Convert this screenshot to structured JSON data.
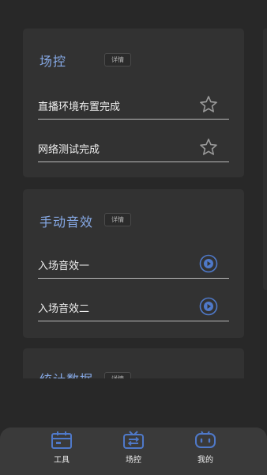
{
  "cards": [
    {
      "title": "场控",
      "detail_label": "详情",
      "items": [
        {
          "label": "直播环境布置完成",
          "icon": "star-outline-icon"
        },
        {
          "label": "网络测试完成",
          "icon": "star-outline-icon"
        }
      ]
    },
    {
      "title": "手动音效",
      "detail_label": "详情",
      "items": [
        {
          "label": "入场音效一",
          "icon": "play-circle-icon"
        },
        {
          "label": "入场音效二",
          "icon": "play-circle-icon"
        }
      ]
    },
    {
      "title": "统计数据",
      "detail_label": "详情",
      "items": []
    }
  ],
  "tabbar": {
    "items": [
      {
        "label": "工具",
        "icon": "calendar-toolbox-icon"
      },
      {
        "label": "场控",
        "icon": "tv-control-icon"
      },
      {
        "label": "我的",
        "icon": "robot-face-icon"
      }
    ]
  },
  "colors": {
    "background": "#282828",
    "card": "#323232",
    "accent_blue": "#86a9e6",
    "icon_blue": "#4f79c9",
    "tabbar": "#3a3a3a"
  }
}
